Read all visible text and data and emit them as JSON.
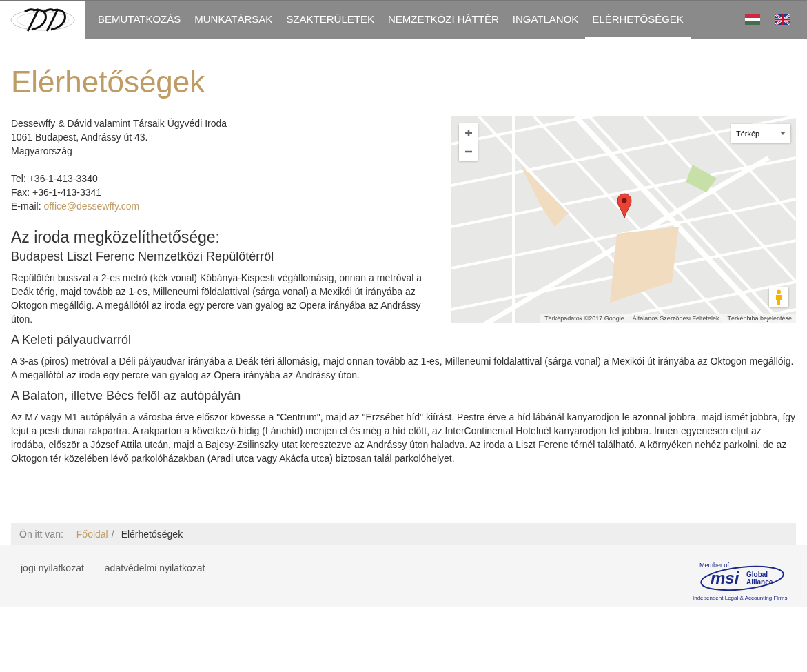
{
  "header": {
    "nav": [
      {
        "label": "BEMUTATKOZÁS",
        "selected": false
      },
      {
        "label": "MUNKATÁRSAK",
        "selected": false
      },
      {
        "label": "SZAKTERÜLETEK",
        "selected": false
      },
      {
        "label": "NEMZETKÖZI HÁTTÉR",
        "selected": false
      },
      {
        "label": "INGATLANOK",
        "selected": false
      },
      {
        "label": "ELÉRHETŐSÉGEK",
        "selected": true
      }
    ],
    "languages": [
      {
        "kind": "hu"
      },
      {
        "kind": "en"
      }
    ]
  },
  "page": {
    "title": "Elérhetőségek",
    "address_lines": [
      "Dessewffy & Dávid valamint Társaik Ügyvédi Iroda",
      "1061 Budapest, Andrássy út 43.",
      "Magyarország"
    ],
    "contacts": [
      {
        "kind": "text",
        "label": "Tel:",
        "value": "+36-1-413-3340"
      },
      {
        "kind": "text",
        "label": "Fax:",
        "value": "+36-1-413-3341"
      },
      {
        "kind": "link",
        "label": "E-mail:",
        "value": "office@dessewffy.com"
      }
    ],
    "map": {
      "map_type": "Térkép",
      "attribution": [
        "Térképadatok ©2017 Google",
        "Általános Szerződési Feltételek",
        "Térképhiba bejelentése"
      ]
    },
    "section_heading": "Az iroda megközelíthetősége:",
    "routes": [
      {
        "heading": "Budapest Liszt Ferenc Nemzetközi Repülőtérről",
        "text": "Repülőtéri busszal a 2-es metró (kék vonal) Kőbánya-Kispesti végállomásig, onnan a metróval a Deák térig, majd tovább az 1-es, Milleneumi földalattival (sárga vonal) a Mexikói út irányába az Oktogon megállóig. A megállótól az iroda egy percre van gyalog az Opera irányába az Andrássy úton."
      },
      {
        "heading": "A Keleti pályaudvarról",
        "text": "A 3-as (piros) metróval a Déli pályaudvar irányába a Deák téri állomásig, majd onnan tovább az 1-es, Milleneumi földalattival (sárga vonal) a Mexikói út irányába az Oktogon megállóig. A megállótól az iroda egy percre van gyalog az Opera irányába az Andrássy úton."
      },
      {
        "heading": "A Balaton, illetve Bécs felől az autópályán",
        "text": "Az M7 vagy M1 autópályán a városba érve először kövesse a \"Centrum\", majd az \"Erzsébet híd\" kiírást. Pestre érve a híd lábánál kanyarodjon le azonnal jobbra, majd ismét jobbra, így lejut a pesti dunai rakpartra. A rakparton a következő hídig (Lánchíd) menjen el és még a híd előtt, az InterContinental Hotelnél kanyarodjon fel jobbra. Innen egyenesen eljut az irodába, először a József Attila utcán, majd a Bajcsy-Zsilinszky utat keresztezve az Andrássy úton haladva. Az iroda a Liszt Ferenc térnél található. A környéken nehéz parkolni, de az Oktogon tér közelében lévő parkolóházakban (Aradi utca vagy Akácfa utca) biztosan talál parkolóhelyet."
      }
    ]
  },
  "breadcrumb": {
    "label": "Ön itt van:",
    "separator": "/",
    "items": [
      {
        "kind": "link",
        "label": "Főoldal"
      },
      {
        "kind": "current",
        "label": "Elérhetőségek"
      }
    ]
  },
  "footer": {
    "links": [
      "jogi nyilatkozat",
      "adatvédelmi nyilatkozat"
    ],
    "badge": {
      "top": "Member of",
      "brand": "msi",
      "name_lines": [
        "Global",
        "Alliance"
      ],
      "bottom": "Independent Legal & Accounting Firms"
    }
  }
}
